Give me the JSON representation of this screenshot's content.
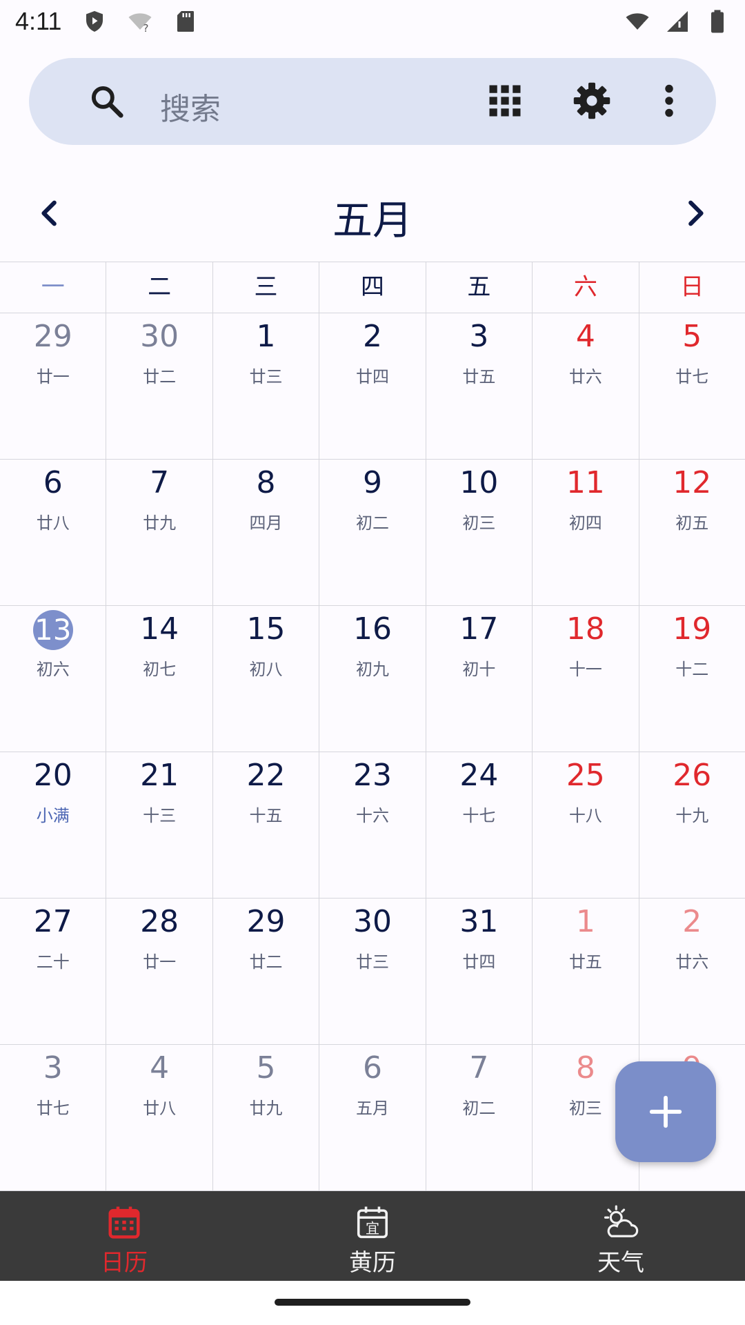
{
  "status_bar": {
    "time": "4:11",
    "icons_left": [
      "shield-icon",
      "wifi-question-icon",
      "sd-card-icon"
    ],
    "icons_right": [
      "wifi-icon",
      "signal-icon",
      "battery-icon"
    ]
  },
  "search": {
    "placeholder": "搜索",
    "icons": [
      "search-icon",
      "apps-grid-icon",
      "settings-gear-icon",
      "more-vertical-icon"
    ]
  },
  "month_header": {
    "title": "五月"
  },
  "weekdays": [
    "一",
    "二",
    "三",
    "四",
    "五",
    "六",
    "日"
  ],
  "weeks": [
    [
      {
        "num": "29",
        "lunar": "廿一",
        "other": true
      },
      {
        "num": "30",
        "lunar": "廿二",
        "other": true
      },
      {
        "num": "1",
        "lunar": "廿三"
      },
      {
        "num": "2",
        "lunar": "廿四"
      },
      {
        "num": "3",
        "lunar": "廿五"
      },
      {
        "num": "4",
        "lunar": "廿六"
      },
      {
        "num": "5",
        "lunar": "廿七"
      }
    ],
    [
      {
        "num": "6",
        "lunar": "廿八"
      },
      {
        "num": "7",
        "lunar": "廿九"
      },
      {
        "num": "8",
        "lunar": "四月"
      },
      {
        "num": "9",
        "lunar": "初二"
      },
      {
        "num": "10",
        "lunar": "初三"
      },
      {
        "num": "11",
        "lunar": "初四"
      },
      {
        "num": "12",
        "lunar": "初五"
      }
    ],
    [
      {
        "num": "13",
        "lunar": "初六",
        "today": true
      },
      {
        "num": "14",
        "lunar": "初七"
      },
      {
        "num": "15",
        "lunar": "初八"
      },
      {
        "num": "16",
        "lunar": "初九"
      },
      {
        "num": "17",
        "lunar": "初十"
      },
      {
        "num": "18",
        "lunar": "十一"
      },
      {
        "num": "19",
        "lunar": "十二"
      }
    ],
    [
      {
        "num": "20",
        "lunar": "小满",
        "term": true
      },
      {
        "num": "21",
        "lunar": "十三"
      },
      {
        "num": "22",
        "lunar": "十五"
      },
      {
        "num": "23",
        "lunar": "十六"
      },
      {
        "num": "24",
        "lunar": "十七"
      },
      {
        "num": "25",
        "lunar": "十八"
      },
      {
        "num": "26",
        "lunar": "十九"
      }
    ],
    [
      {
        "num": "27",
        "lunar": "二十"
      },
      {
        "num": "28",
        "lunar": "廿一"
      },
      {
        "num": "29",
        "lunar": "廿二"
      },
      {
        "num": "30",
        "lunar": "廿三"
      },
      {
        "num": "31",
        "lunar": "廿四"
      },
      {
        "num": "1",
        "lunar": "廿五",
        "other": true
      },
      {
        "num": "2",
        "lunar": "廿六",
        "other": true
      }
    ],
    [
      {
        "num": "3",
        "lunar": "廿七",
        "other": true
      },
      {
        "num": "4",
        "lunar": "廿八",
        "other": true
      },
      {
        "num": "5",
        "lunar": "廿九",
        "other": true
      },
      {
        "num": "6",
        "lunar": "五月",
        "other": true
      },
      {
        "num": "7",
        "lunar": "初二",
        "other": true
      },
      {
        "num": "8",
        "lunar": "初三",
        "other": true
      },
      {
        "num": "9",
        "lunar": "",
        "other": true
      }
    ]
  ],
  "fab": {
    "icon": "plus-icon"
  },
  "bottom_nav": {
    "items": [
      {
        "label": "日历",
        "icon": "calendar-icon",
        "active": true
      },
      {
        "label": "黄历",
        "icon": "almanac-icon",
        "active": false
      },
      {
        "label": "天气",
        "icon": "weather-icon",
        "active": false
      }
    ]
  },
  "colors": {
    "accent": "#7d8fcb",
    "weekend": "#e0282d",
    "text": "#0e1a47",
    "search_bg": "#dde3f3",
    "nav_bg": "#3a3a3a"
  }
}
